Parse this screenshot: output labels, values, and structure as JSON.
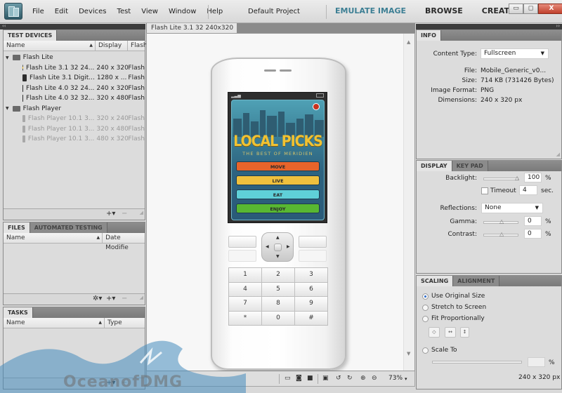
{
  "menubar": {
    "menus": [
      "File",
      "Edit",
      "Devices",
      "Test",
      "View",
      "Window",
      "Help"
    ],
    "project": "Default Project",
    "modes": [
      {
        "label": "EMULATE IMAGE",
        "active": true
      },
      {
        "label": "BROWSE",
        "active": false
      },
      {
        "label": "CREATE",
        "active": false
      }
    ],
    "window_buttons": {
      "minimize": "▭",
      "restore": "◻",
      "close": "X"
    }
  },
  "collapse_left": "‹‹",
  "collapse_right": "››",
  "test_devices": {
    "tab": "TEST DEVICES",
    "columns": [
      "Name",
      "Display",
      "Flash"
    ],
    "groups": [
      {
        "name": "Flash Lite",
        "devices": [
          {
            "name": "Flash Lite 3.1 32 24...",
            "display": "240 x 320",
            "flash": "Flash",
            "icon": "active-device-icon",
            "dimmed": false
          },
          {
            "name": "Flash Lite 3.1 Digit...",
            "display": "1280 x ...",
            "flash": "Flash",
            "icon": "phone-icon",
            "dimmed": false
          },
          {
            "name": "Flash Lite 4.0 32 24...",
            "display": "240 x 320",
            "flash": "Flash",
            "icon": "phone-icon",
            "dimmed": false
          },
          {
            "name": "Flash Lite 4.0 32 32...",
            "display": "320 x 480",
            "flash": "Flash",
            "icon": "phone-icon",
            "dimmed": false
          }
        ]
      },
      {
        "name": "Flash Player",
        "devices": [
          {
            "name": "Flash Player 10.1 3...",
            "display": "320 x 240",
            "flash": "Flash",
            "icon": "phone-icon",
            "dimmed": true
          },
          {
            "name": "Flash Player 10.1 3...",
            "display": "320 x 480",
            "flash": "Flash",
            "icon": "phone-icon",
            "dimmed": true
          },
          {
            "name": "Flash Player 10.1 3...",
            "display": "480 x 320",
            "flash": "Flash",
            "icon": "phone-icon",
            "dimmed": true
          }
        ]
      }
    ],
    "add": "+▾",
    "remove": "−"
  },
  "files": {
    "tabs": [
      "FILES",
      "AUTOMATED TESTING"
    ],
    "columns": [
      "Name",
      "Date Modifie"
    ],
    "settings": "✲▾",
    "add": "+▾",
    "remove": "−"
  },
  "tasks": {
    "tab": "TASKS",
    "columns": [
      "Name",
      "Type"
    ],
    "add": "+▾",
    "remove": "−"
  },
  "stage": {
    "tab": "Flash Lite 3.1 32 240x320",
    "zoom": "73%",
    "zoom_arrow": "▾",
    "phone": {
      "app_title": "LOCAL PICKS",
      "app_subtitle": "THE BEST OF MERIDIEN",
      "buttons": [
        {
          "label": "MOVE",
          "color": "#e8642a"
        },
        {
          "label": "LIVE",
          "color": "#efc03d"
        },
        {
          "label": "EAT",
          "color": "#5fd0d8"
        },
        {
          "label": "ENJOY",
          "color": "#58b832"
        }
      ],
      "keys": [
        "1",
        "2",
        "3",
        "4",
        "5",
        "6",
        "7",
        "8",
        "9",
        "*",
        "0",
        "#"
      ]
    }
  },
  "info": {
    "tab": "INFO",
    "content_type_label": "Content Type:",
    "content_type_value": "Fullscreen",
    "file_label": "File:",
    "file_value": "Mobile_Generic_v0...",
    "size_label": "Size:",
    "size_value": "714 KB (731426 Bytes)",
    "format_label": "Image Format:",
    "format_value": "PNG",
    "dimensions_label": "Dimensions:",
    "dimensions_value": "240 x 320 px"
  },
  "display": {
    "tabs": [
      "DISPLAY",
      "KEY PAD"
    ],
    "backlight_label": "Backlight:",
    "backlight_value": "100",
    "backlight_level": 1.0,
    "percent": "%",
    "timeout_label": "Timeout",
    "timeout_checked": false,
    "timeout_value": "4",
    "sec": "sec.",
    "reflections_label": "Reflections:",
    "reflections_value": "None",
    "gamma_label": "Gamma:",
    "gamma_value": "0",
    "contrast_label": "Contrast:",
    "contrast_value": "0"
  },
  "scaling": {
    "tabs": [
      "SCALING",
      "ALIGNMENT"
    ],
    "options": [
      {
        "label": "Use Original Size",
        "selected": true
      },
      {
        "label": "Stretch to Screen",
        "selected": false
      },
      {
        "label": "Fit Proportionally",
        "selected": false
      },
      {
        "label": "Scale To",
        "selected": false
      }
    ],
    "scale_value": "",
    "percent": "%",
    "size_readout": "240 x 320 px"
  },
  "watermark": "OceanofDMG",
  "colors": {
    "accent": "#3d7f94",
    "panel_bg": "#dcdcdc",
    "tab_strip": "#8b8b8b"
  }
}
